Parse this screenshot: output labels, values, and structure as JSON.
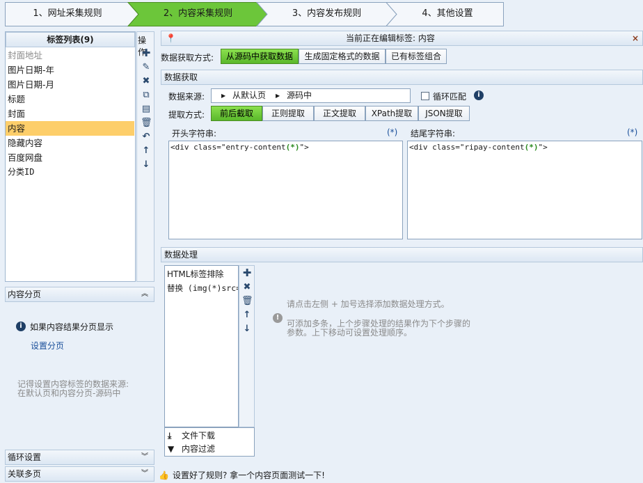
{
  "steps": [
    {
      "label": "1、网址采集规则",
      "active": false
    },
    {
      "label": "2、内容采集规则",
      "active": true
    },
    {
      "label": "3、内容发布规则",
      "active": false
    },
    {
      "label": "4、其他设置",
      "active": false
    }
  ],
  "tag_list": {
    "title": "标签列表(9)",
    "ops_label": "操作",
    "items": [
      {
        "label": "封面地址",
        "muted": true
      },
      {
        "label": "图片日期-年"
      },
      {
        "label": "图片日期-月"
      },
      {
        "label": "标题"
      },
      {
        "label": "封面"
      },
      {
        "label": "内容",
        "selected": true
      },
      {
        "label": "隐藏内容"
      },
      {
        "label": "百度网盘"
      },
      {
        "label": "分类ID"
      }
    ]
  },
  "editing": {
    "label": "当前正在编辑标签: 内容",
    "close": "×"
  },
  "method": {
    "label": "数据获取方式:",
    "options": [
      "从源码中获取数据",
      "生成固定格式的数据",
      "已有标签组合"
    ],
    "active_index": 0
  },
  "fetch": {
    "section_title": "数据获取",
    "source_label": "数据来源:",
    "source_path": [
      "从默认页",
      "源码中"
    ],
    "loop_label": "循环匹配",
    "extract_label": "提取方式:",
    "extract_options": [
      "前后截取",
      "正则提取",
      "正文提取",
      "XPath提取",
      "JSON提取"
    ],
    "extract_active": 0,
    "start_label": "开头字符串:",
    "start_hint": "(*)",
    "start_prefix": "<div class=\"entry-content",
    "start_token": "(*)",
    "start_suffix": "\">",
    "end_label": "结尾字符串:",
    "end_hint": "(*)",
    "end_prefix": "<div class=\"ripay-content",
    "end_token": "(*)",
    "end_suffix": "\">"
  },
  "process": {
    "section_title": "数据处理",
    "items": [
      "HTML标签排除",
      "替换 (img(*)src=\""
    ],
    "bottom": [
      "文件下载",
      "内容过滤"
    ],
    "hint1": "请点击左侧 + 加号选择添加数据处理方式。",
    "hint2_line1": "可添加多条，上个步骤处理的结果作为下个步骤的",
    "hint2_line2": "参数。上下移动可设置处理顺序。"
  },
  "paging": {
    "title": "内容分页",
    "info": "如果内容结果分页显示",
    "link": "设置分页",
    "note_line1": "记得设置内容标签的数据来源:",
    "note_line2": "在默认页和内容分页-源码中"
  },
  "loop_settings": {
    "title": "循环设置"
  },
  "multi_page": {
    "title": "关联多页"
  },
  "footer": {
    "text": "设置好了规则? 拿一个内容页面测试一下!"
  },
  "colors": {
    "accent_green": "#6cc63a",
    "selected_row": "#fdce6a",
    "panel_bg": "#e9f0f8"
  }
}
